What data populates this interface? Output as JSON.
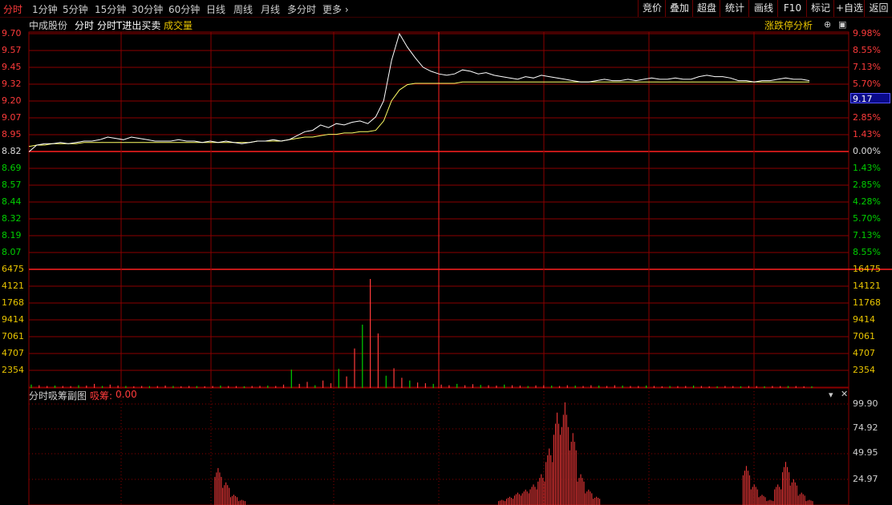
{
  "topbar": {
    "period_tabs": [
      "分时",
      "1分钟",
      "5分钟",
      "15分钟",
      "30分钟",
      "60分钟",
      "日线",
      "周线",
      "月线",
      "多分时",
      "更多"
    ],
    "active_tab": "分时",
    "right_buttons": [
      "竞价",
      "叠加",
      "超盘",
      "统计",
      "画线",
      "F10",
      "标记",
      "+自选",
      "返回"
    ]
  },
  "info": {
    "stock_name": "中成股份",
    "mode": "分时",
    "indicator": "分时T进出买卖",
    "volume_label": "成交量",
    "analysis_link": "涨跌停分析"
  },
  "price_axis": {
    "left": [
      "9.70",
      "9.57",
      "9.45",
      "9.32",
      "9.20",
      "9.07",
      "8.95",
      "8.82",
      "8.69",
      "8.57",
      "8.44",
      "8.32",
      "8.19",
      "8.07"
    ],
    "right": [
      "9.98%",
      "8.55%",
      "7.13%",
      "5.70%",
      "",
      "2.85%",
      "1.43%",
      "0.00%",
      "1.43%",
      "2.85%",
      "4.28%",
      "5.70%",
      "7.13%",
      "8.55%"
    ],
    "current_price": "9.17",
    "prev_close": "8.82"
  },
  "volume_axis": {
    "left": [
      "6475",
      "4121",
      "1768",
      "9414",
      "7061",
      "4707",
      "2354"
    ],
    "right": [
      "16475",
      "14121",
      "11768",
      "9414",
      "7061",
      "4707",
      "2354"
    ]
  },
  "sub_chart": {
    "title": "分时吸筹副图",
    "series_label": "吸筹:",
    "series_value": "0.00",
    "axis": [
      "99.90",
      "74.92",
      "49.95",
      "24.97"
    ]
  },
  "colors": {
    "up": "#ff3b3b",
    "down": "#00d000",
    "price_line": "#ffffff",
    "avg_line": "#ffff66",
    "grid": "#8b0000",
    "axis_yellow": "#e8c400"
  },
  "chart_data": [
    {
      "type": "line",
      "title": "",
      "series": [
        {
          "name": "",
          "values": [
            8.82,
            8.87,
            8.88,
            8.88,
            8.89,
            8.88,
            8.89,
            8.9,
            8.9,
            8.91,
            8.93,
            8.92,
            8.91,
            8.93,
            8.92,
            8.91,
            8.9,
            8.9,
            8.9,
            8.91,
            8.9,
            8.9,
            8.89,
            8.9,
            8.89,
            8.9,
            8.89,
            8.88,
            8.89,
            8.9,
            8.9,
            8.91,
            8.9,
            8.91,
            8.94,
            8.97,
            8.98,
            9.02,
            9.0,
            9.03,
            9.02,
            9.04,
            9.05,
            9.03,
            9.08,
            9.2,
            9.5,
            9.7,
            9.6,
            9.52,
            9.45,
            9.42,
            9.4,
            9.39,
            9.4,
            9.43,
            9.42,
            9.4,
            9.41,
            9.39,
            9.38,
            9.37,
            9.36,
            9.38,
            9.37,
            9.39,
            9.38,
            9.37,
            9.36,
            9.35,
            9.34,
            9.34,
            9.35,
            9.36,
            9.35,
            9.35,
            9.36,
            9.35,
            9.36,
            9.37,
            9.36,
            9.36,
            9.37,
            9.36,
            9.36,
            9.38,
            9.39,
            9.38,
            9.38,
            9.37,
            9.35,
            9.35,
            9.34,
            9.35,
            9.35,
            9.36,
            9.37,
            9.36,
            9.36,
            9.35
          ]
        },
        {
          "name": "",
          "values": [
            8.86,
            8.87,
            8.87,
            8.88,
            8.88,
            8.88,
            8.88,
            8.89,
            8.89,
            8.89,
            8.89,
            8.89,
            8.89,
            8.89,
            8.89,
            8.89,
            8.89,
            8.89,
            8.89,
            8.89,
            8.89,
            8.89,
            8.89,
            8.89,
            8.89,
            8.89,
            8.89,
            8.89,
            8.89,
            8.9,
            8.9,
            8.9,
            8.9,
            8.91,
            8.92,
            8.93,
            8.93,
            8.94,
            8.95,
            8.95,
            8.96,
            8.96,
            8.97,
            8.97,
            8.98,
            9.05,
            9.2,
            9.28,
            9.32,
            9.33,
            9.33,
            9.33,
            9.33,
            9.33,
            9.33,
            9.34,
            9.34,
            9.34,
            9.34,
            9.34,
            9.34,
            9.34,
            9.34,
            9.34,
            9.34,
            9.34,
            9.34,
            9.34,
            9.34,
            9.34,
            9.34,
            9.34,
            9.34,
            9.34,
            9.34,
            9.34,
            9.34,
            9.34,
            9.34,
            9.34,
            9.34,
            9.34,
            9.34,
            9.34,
            9.34,
            9.34,
            9.34,
            9.34,
            9.34,
            9.34,
            9.34,
            9.34,
            9.34,
            9.34,
            9.34,
            9.34,
            9.34,
            9.34,
            9.34,
            9.34
          ]
        }
      ],
      "ylim": [
        8.07,
        9.7
      ],
      "grid": true
    },
    {
      "type": "bar",
      "title": "",
      "ylabel": "成交量",
      "values": [
        500,
        400,
        300,
        350,
        300,
        280,
        400,
        350,
        600,
        300,
        500,
        350,
        300,
        250,
        300,
        280,
        300,
        350,
        300,
        250,
        300,
        280,
        250,
        300,
        350,
        300,
        280,
        250,
        300,
        320,
        350,
        300,
        500,
        2700,
        600,
        900,
        400,
        1100,
        700,
        2800,
        1700,
        5800,
        9300,
        16000,
        8000,
        1800,
        2900,
        1500,
        1100,
        800,
        700,
        600,
        500,
        400,
        600,
        400,
        550,
        450,
        400,
        350,
        500,
        400,
        350,
        300,
        380,
        400,
        350,
        300,
        400,
        350,
        300,
        400,
        350,
        300,
        400,
        350,
        300,
        300,
        350,
        300,
        250,
        300,
        280,
        300,
        350,
        300,
        250,
        250,
        300,
        280,
        250,
        300,
        280,
        250,
        300,
        280,
        300,
        280,
        250,
        250
      ],
      "colors": [
        "up",
        "down"
      ],
      "ylim": [
        0,
        16475
      ],
      "grid": true
    },
    {
      "type": "bar",
      "title": "分时吸筹副图",
      "values": [
        0,
        0,
        0,
        0,
        0,
        0,
        0,
        0,
        0,
        0,
        0,
        0,
        0,
        0,
        0,
        0,
        0,
        0,
        0,
        0,
        0,
        0,
        0,
        0,
        36,
        22,
        10,
        5,
        0,
        0,
        0,
        0,
        0,
        0,
        0,
        0,
        0,
        0,
        0,
        0,
        0,
        0,
        0,
        0,
        0,
        0,
        0,
        0,
        0,
        0,
        0,
        0,
        0,
        0,
        0,
        0,
        0,
        0,
        0,
        0,
        5,
        8,
        12,
        15,
        20,
        30,
        55,
        90,
        99.9,
        70,
        30,
        15,
        8,
        0,
        0,
        0,
        0,
        0,
        0,
        0,
        0,
        0,
        0,
        0,
        0,
        0,
        0,
        0,
        0,
        0,
        0,
        38,
        20,
        10,
        5,
        20,
        42,
        25,
        12,
        5
      ],
      "ylim": [
        0,
        99.9
      ],
      "grid": true
    }
  ]
}
